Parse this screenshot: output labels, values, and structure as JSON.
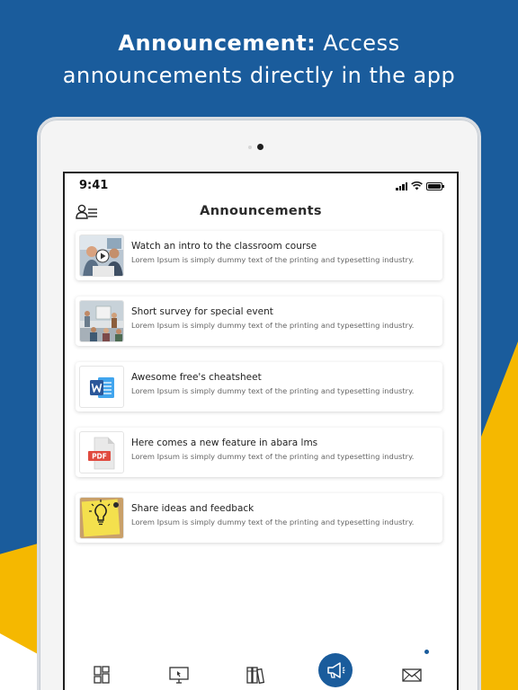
{
  "colors": {
    "brand_blue": "#1a5c9c",
    "accent_yellow": "#f5b800",
    "word_blue": "#2b579a",
    "pdf_red": "#e04a3f"
  },
  "headline": {
    "bold": "Announcement:",
    "line1_rest": " Access",
    "line2": "announcements directly in the app"
  },
  "status_bar": {
    "time": "9:41",
    "icons": [
      "signal-icon",
      "wifi-icon",
      "battery-icon"
    ]
  },
  "header": {
    "title": "Announcements",
    "profile_icon": "profile-list-icon"
  },
  "announcements": [
    {
      "title": "Watch an intro to the classroom course",
      "description": "Lorem Ipsum is simply dummy text of the printing and typesetting industry.",
      "thumbnail": "video-thumbnail"
    },
    {
      "title": "Short survey for special event",
      "description": "Lorem Ipsum is simply dummy text of the printing and typesetting industry.",
      "thumbnail": "classroom-photo-thumbnail"
    },
    {
      "title": "Awesome free's cheatsheet",
      "description": "Lorem Ipsum is simply dummy text of the printing and typesetting industry.",
      "thumbnail": "word-document-icon"
    },
    {
      "title": "Here comes a new feature in abara lms",
      "description": "Lorem Ipsum is simply dummy text of the printing and typesetting industry.",
      "thumbnail": "pdf-document-icon",
      "thumb_label": "PDF"
    },
    {
      "title": "Share ideas and feedback",
      "description": "Lorem Ipsum is simply dummy text of the printing and typesetting industry.",
      "thumbnail": "lightbulb-note-thumbnail"
    }
  ],
  "tab_bar": {
    "tabs": [
      "dashboard-icon",
      "monitor-icon",
      "library-icon",
      "megaphone-icon",
      "mail-icon"
    ],
    "active": "megaphone-icon",
    "badge_on": "mail-icon"
  }
}
